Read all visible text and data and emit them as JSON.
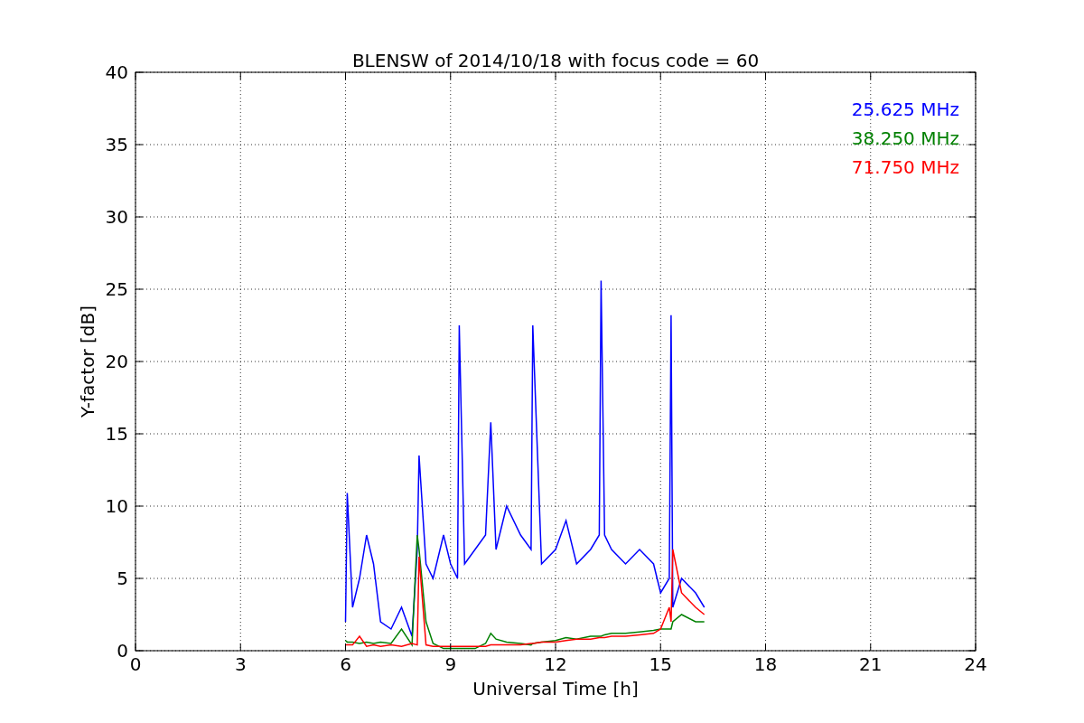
{
  "chart_data": {
    "type": "line",
    "title": "BLENSW of 2014/10/18 with focus code = 60",
    "xlabel": "Universal Time [h]",
    "ylabel": "Y-factor [dB]",
    "x": [
      6.0,
      6.05,
      6.2,
      6.4,
      6.6,
      6.8,
      7.0,
      7.3,
      7.6,
      7.9,
      8.05,
      8.1,
      8.3,
      8.5,
      8.8,
      9.0,
      9.2,
      9.25,
      9.4,
      9.7,
      10.0,
      10.15,
      10.3,
      10.6,
      11.0,
      11.3,
      11.35,
      11.6,
      12.0,
      12.3,
      12.6,
      13.0,
      13.25,
      13.3,
      13.4,
      13.6,
      14.0,
      14.4,
      14.8,
      15.0,
      15.25,
      15.3,
      15.35,
      15.6,
      16.0,
      16.25
    ],
    "series": [
      {
        "name": "25.625 MHz",
        "color": "#0000ff",
        "values": [
          2,
          10.9,
          3,
          5,
          8,
          6,
          2,
          1.5,
          3,
          1,
          7,
          13.5,
          6,
          5,
          8,
          6,
          5,
          22.5,
          6,
          7,
          8,
          15.8,
          7,
          10,
          8,
          7,
          22.5,
          6,
          7,
          9,
          6,
          7,
          8,
          25.6,
          8,
          7,
          6,
          7,
          6,
          4,
          5,
          23.2,
          3,
          5,
          4,
          3
        ]
      },
      {
        "name": "38.250 MHz",
        "color": "#008000",
        "values": [
          0.7,
          0.6,
          0.6,
          0.5,
          0.6,
          0.5,
          0.6,
          0.5,
          1.5,
          0.4,
          8,
          7,
          2,
          0.5,
          0.15,
          0.15,
          0.15,
          0.15,
          0.15,
          0.15,
          0.5,
          1.2,
          0.8,
          0.6,
          0.5,
          0.4,
          0.5,
          0.6,
          0.7,
          0.9,
          0.8,
          1.0,
          1.0,
          1.0,
          1.1,
          1.2,
          1.2,
          1.3,
          1.4,
          1.5,
          1.5,
          1.5,
          2.0,
          2.5,
          2.0,
          2.0
        ]
      },
      {
        "name": "71.750 MHz",
        "color": "#ff0000",
        "values": [
          0.4,
          0.4,
          0.4,
          1.0,
          0.3,
          0.4,
          0.3,
          0.4,
          0.3,
          0.5,
          0.4,
          6.5,
          0.4,
          0.3,
          0.3,
          0.3,
          0.3,
          0.3,
          0.3,
          0.3,
          0.3,
          0.4,
          0.4,
          0.4,
          0.4,
          0.5,
          0.5,
          0.6,
          0.6,
          0.7,
          0.8,
          0.8,
          0.9,
          0.9,
          0.9,
          1.0,
          1.0,
          1.1,
          1.2,
          1.5,
          3,
          2,
          7,
          4,
          3,
          2.5
        ]
      }
    ],
    "grid": true,
    "xlim": [
      0,
      24
    ],
    "ylim": [
      0,
      40
    ],
    "xticks": [
      0,
      3,
      6,
      9,
      12,
      15,
      18,
      21,
      24
    ],
    "yticks": [
      0,
      5,
      10,
      15,
      20,
      25,
      30,
      35,
      40
    ]
  }
}
